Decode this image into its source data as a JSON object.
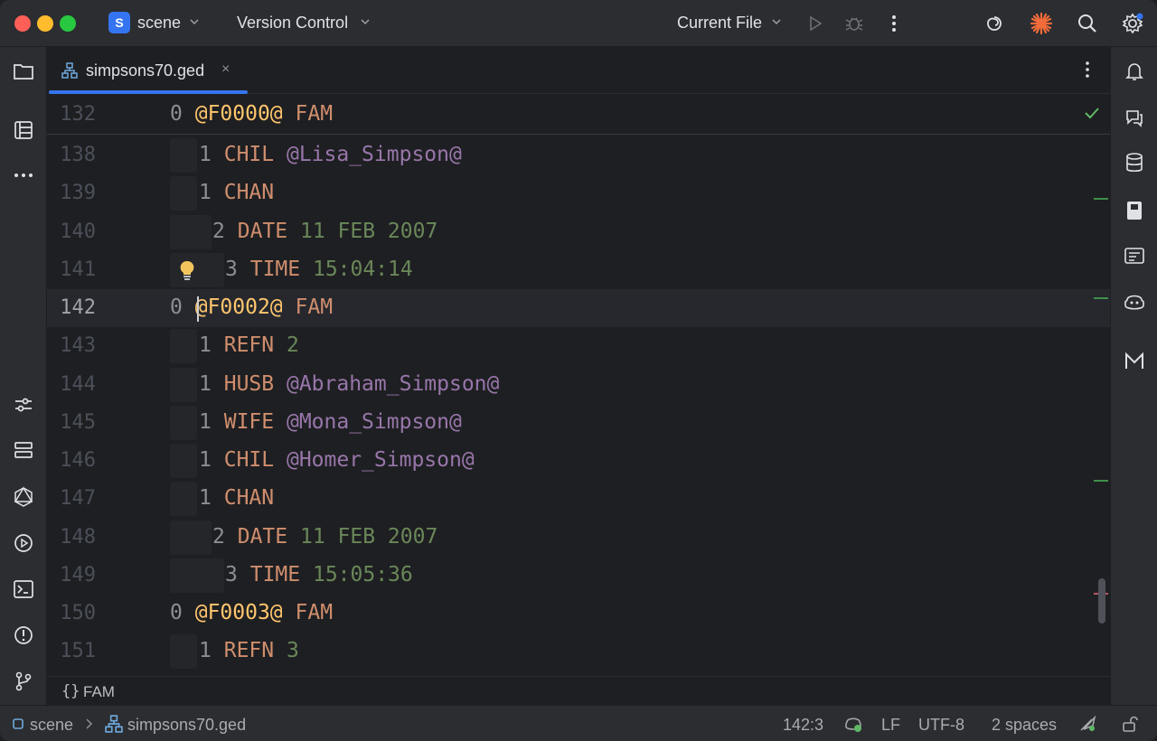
{
  "titlebar": {
    "project_badge": "S",
    "project_name": "scene",
    "vcs_label": "Version Control",
    "run_config": "Current File",
    "icons": [
      "run-icon",
      "debug-icon",
      "more-icon",
      "ai-spiral-icon",
      "burst-icon",
      "search-icon",
      "settings-icon"
    ]
  },
  "tab": {
    "filename": "simpsons70.ged",
    "close": "×"
  },
  "sticky_line": {
    "number": "132",
    "level": "0",
    "xref": "@F0000@",
    "tag": "FAM"
  },
  "lines": [
    {
      "number": "138",
      "level": "1",
      "tag": "CHIL",
      "value": "@Lisa_Simpson@",
      "kind": "ptr"
    },
    {
      "number": "139",
      "level": "1",
      "tag": "CHAN",
      "value": "",
      "kind": "none"
    },
    {
      "number": "140",
      "level": "2",
      "tag": "DATE",
      "value": "11 FEB 2007",
      "kind": "val"
    },
    {
      "number": "141",
      "level": "3",
      "tag": "TIME",
      "value": "15:04:14",
      "kind": "val"
    },
    {
      "number": "142",
      "level": "0",
      "tag": "FAM",
      "value": "@F0002@",
      "kind": "xref"
    },
    {
      "number": "143",
      "level": "1",
      "tag": "REFN",
      "value": "2",
      "kind": "val"
    },
    {
      "number": "144",
      "level": "1",
      "tag": "HUSB",
      "value": "@Abraham_Simpson@",
      "kind": "ptr"
    },
    {
      "number": "145",
      "level": "1",
      "tag": "WIFE",
      "value": "@Mona_Simpson@",
      "kind": "ptr"
    },
    {
      "number": "146",
      "level": "1",
      "tag": "CHIL",
      "value": "@Homer_Simpson@",
      "kind": "ptr"
    },
    {
      "number": "147",
      "level": "1",
      "tag": "CHAN",
      "value": "",
      "kind": "none"
    },
    {
      "number": "148",
      "level": "2",
      "tag": "DATE",
      "value": "11 FEB 2007",
      "kind": "val"
    },
    {
      "number": "149",
      "level": "3",
      "tag": "TIME",
      "value": "15:05:36",
      "kind": "val"
    },
    {
      "number": "150",
      "level": "0",
      "tag": "FAM",
      "value": "@F0003@",
      "kind": "xref"
    },
    {
      "number": "151",
      "level": "1",
      "tag": "REFN",
      "value": "3",
      "kind": "val"
    }
  ],
  "current_line": "142",
  "breadcrumb": {
    "braces": "{}",
    "label": "FAM"
  },
  "statusbar": {
    "project": "scene",
    "file": "simpsons70.ged",
    "position": "142:3",
    "line_ending": "LF",
    "encoding": "UTF-8",
    "indent": "2 spaces"
  },
  "colors": {
    "accent": "#3574f0",
    "tag": "#cf8e6d",
    "pointer": "#9876aa",
    "value": "#6a8759",
    "xref": "#ffc66d"
  }
}
